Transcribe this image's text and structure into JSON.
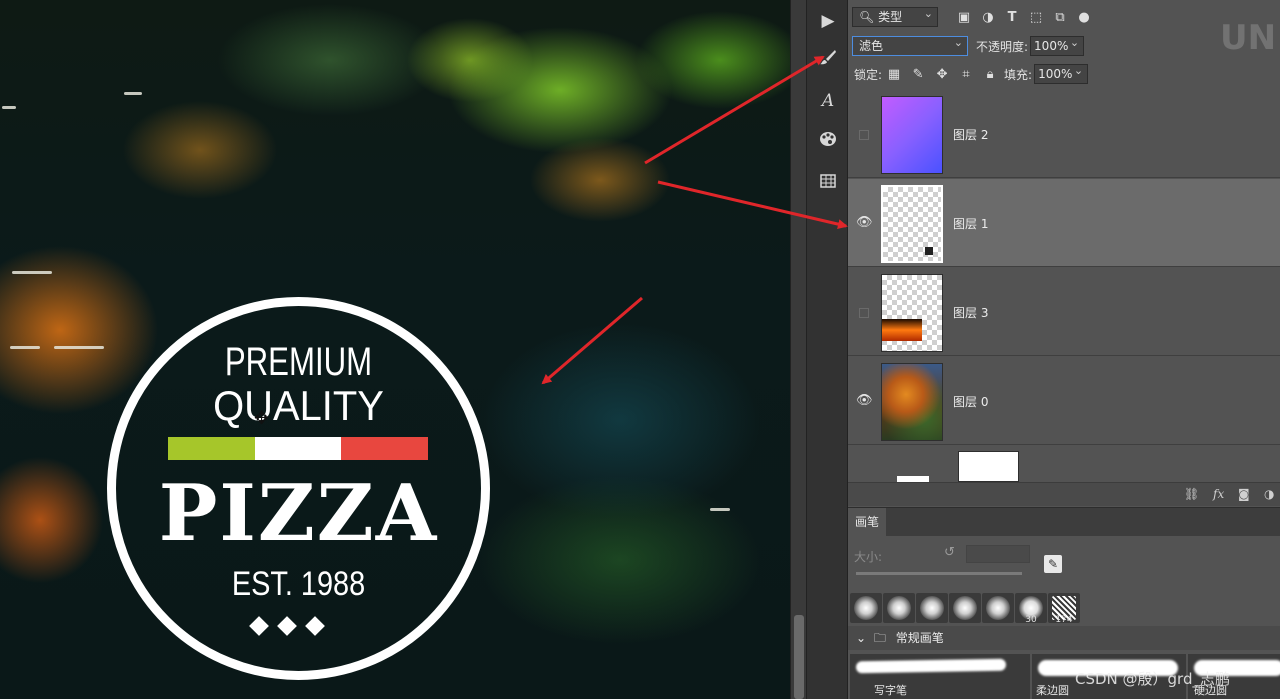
{
  "canvas": {
    "logo": {
      "line1": "PREMIUM",
      "line2": "QUALITY",
      "line3": "PIZZA",
      "line4": "EST. 1988",
      "bar_colors": [
        "#a6c62a",
        "#ffffff",
        "#e8473f"
      ]
    }
  },
  "layers_panel": {
    "filter_label": "类型",
    "blend_mode": "滤色",
    "opacity_label": "不透明度:",
    "opacity_value": "100%",
    "lock_label": "锁定:",
    "fill_label": "填充:",
    "fill_value": "100%",
    "layers": [
      {
        "name": "图层 2",
        "visible": false,
        "selected": false
      },
      {
        "name": "图层 1",
        "visible": true,
        "selected": true
      },
      {
        "name": "图层 3",
        "visible": false,
        "selected": false
      },
      {
        "name": "图层 0",
        "visible": true,
        "selected": false
      }
    ]
  },
  "brush_panel": {
    "tab_label": "画笔",
    "size_label": "大小:",
    "tips": [
      {
        "number": ""
      },
      {
        "number": ""
      },
      {
        "number": ""
      },
      {
        "number": ""
      },
      {
        "number": ""
      },
      {
        "number": "30"
      },
      {
        "number": "174"
      }
    ],
    "group_label": "常规画笔",
    "strokes": [
      {
        "label": "写字笔"
      },
      {
        "label": "柔边圆"
      },
      {
        "label": "硬边圆"
      }
    ]
  },
  "watermark": "CSDN @殷）grd_志鹏",
  "colors": {
    "panel_bg": "#535353",
    "arrow": "#e0262a",
    "selection_border": "#4d8de0"
  }
}
